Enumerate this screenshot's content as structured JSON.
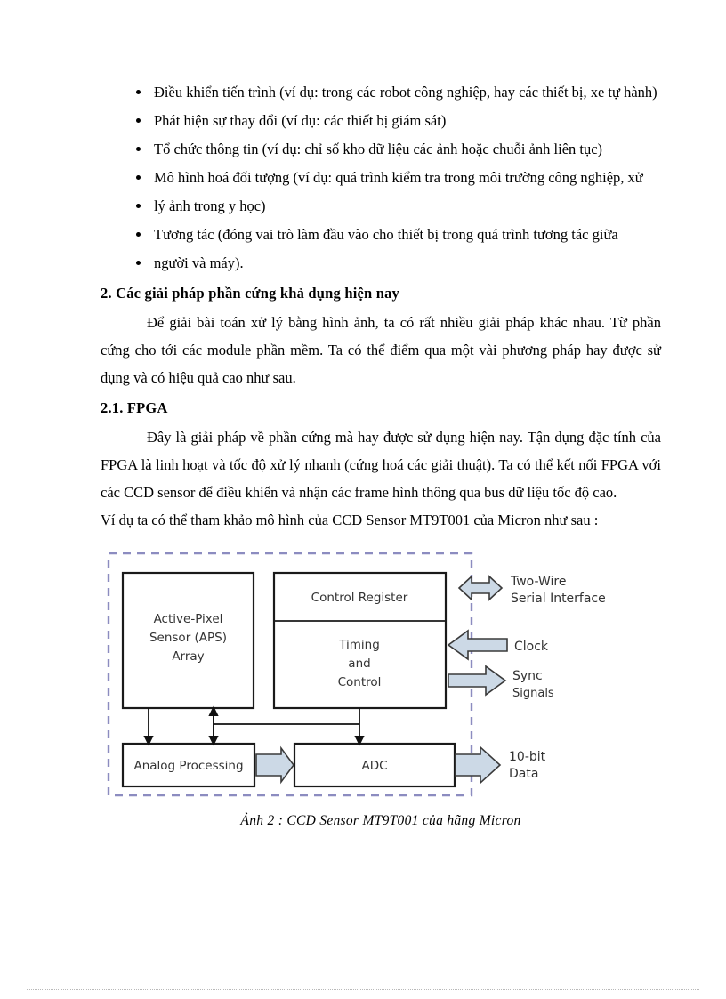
{
  "document": {
    "bullets": [
      "Điều khiển tiến trình (ví dụ: trong các robot công nghiệp, hay các thiết bị, xe tự hành)",
      "Phát hiện sự thay đổi (ví dụ: các thiết bị giám sát)",
      "Tổ chức thông tin (ví dụ: chỉ số kho dữ liệu các ảnh hoặc chuỗi ảnh liên tục)",
      "Mô hình hoá đối tượng (ví dụ: quá trình kiểm tra trong môi trường công nghiệp, xử",
      "lý ảnh trong y học)",
      "Tương tác (đóng vai trò làm đầu vào cho thiết bị trong quá trình tương tác giữa",
      "người và máy)."
    ],
    "section_heading": "2. Các giải pháp phần cứng khả dụng hiện nay",
    "section_paragraph": "Để giải bài toán xử lý bằng hình ảnh, ta có rất nhiều giải pháp khác nhau. Từ phần cứng cho tới các module phần mềm. Ta có thể điểm qua một vài phương pháp hay được sử dụng và có hiệu quả cao như sau.",
    "subsection_heading": "2.1. FPGA",
    "subsection_paragraph": "Đây là giải pháp về phần cứng mà hay được sử dụng hiện nay. Tận dụng đặc tính của FPGA là linh hoạt và tốc độ xử lý nhanh (cứng hoá các giải thuật). Ta có thể kết nối FPGA với các CCD sensor để điều khiển và nhận các frame hình thông qua bus dữ liệu tốc độ cao.",
    "figure_intro": "Ví dụ ta có thể tham khảo mô hình của CCD Sensor MT9T001 của Micron như sau :",
    "figure_caption": "Ảnh 2 :  CCD Sensor MT9T001 của hãng Micron"
  },
  "figure": {
    "blocks": {
      "aps_line1": "Active-Pixel",
      "aps_line2": "Sensor (APS)",
      "aps_line3": "Array",
      "control_register": "Control Register",
      "timing_line1": "Timing",
      "timing_line2": "and",
      "timing_line3": "Control",
      "analog_processing": "Analog Processing",
      "adc": "ADC"
    },
    "labels": {
      "two_wire_line1": "Two-Wire",
      "two_wire_line2": "Serial Interface",
      "clock": "Clock",
      "sync_line1": "Sync",
      "sync_line2": "Signals",
      "data_line1": "10-bit",
      "data_line2": "Data"
    },
    "colors": {
      "dashed_boundary": "#8c8cc0",
      "arrow_fill": "#ccd9e6",
      "arrow_stroke": "#3a3a3a",
      "block_stroke": "#1a1a1a",
      "text": "#333333"
    }
  }
}
